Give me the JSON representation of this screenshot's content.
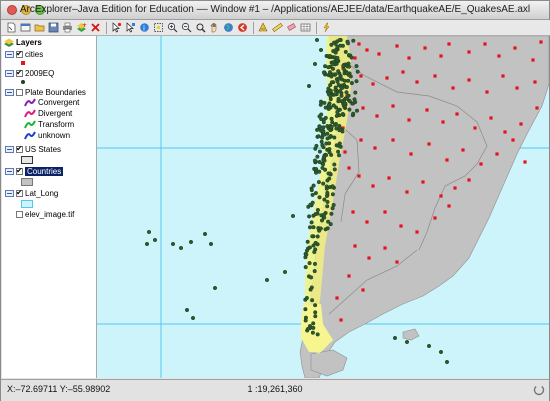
{
  "window": {
    "title": "ArcExplorer–Java Edition for Education –– Window #1 – /Applications/AEJEE/data/EarthquakeAE/E_QuakesAE.axl"
  },
  "toolbar": {
    "icons": [
      "new-doc",
      "open-folder",
      "save",
      "print",
      "add-layer",
      "remove-layer",
      "pointer",
      "pan",
      "identify",
      "zoom-in",
      "zoom-out",
      "find",
      "full-extent",
      "previous-extent",
      "globe",
      "query",
      "measure",
      "edit",
      "lightning"
    ]
  },
  "layers": {
    "root_label": "Layers",
    "items": [
      {
        "name": "cities",
        "checked": true,
        "expanded": true
      },
      {
        "name": "2009EQ",
        "checked": true,
        "expanded": true
      },
      {
        "name": "Plate Boundaries",
        "checked": false,
        "expanded": true
      },
      {
        "name": "US States",
        "checked": true,
        "expanded": true
      },
      {
        "name": "Countries",
        "checked": true,
        "expanded": true,
        "selected": true
      },
      {
        "name": "Lat_Long",
        "checked": true,
        "expanded": true
      },
      {
        "name": "elev_image.tif",
        "checked": false,
        "expanded": false
      }
    ],
    "plate_legend": [
      "Convergent",
      "Divergent",
      "Transform",
      "unknown"
    ]
  },
  "colors": {
    "ocean": "#cdf4fb",
    "land": "#c2c2c2",
    "elevation": "#f4f27a",
    "city": "#e8121b",
    "quake": "#1f3f1f",
    "quake_fill": "#2d5a2d",
    "grid": "#52c8ee",
    "selection": "#0b2266",
    "convergent": "#8a1cb3",
    "divergent": "#e0197a",
    "transform": "#19b530",
    "unknown": "#1b3fd6"
  },
  "status": {
    "coordinates": "X:–72.69711 Y:–55.98902",
    "scale": "1 :19,261,360"
  }
}
